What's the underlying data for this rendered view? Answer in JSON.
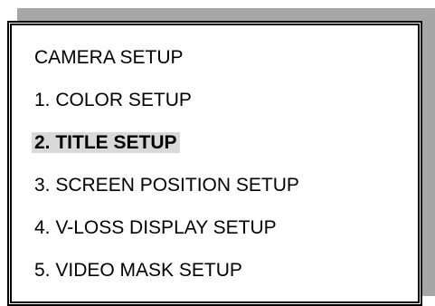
{
  "menu": {
    "title": "CAMERA SETUP",
    "items": [
      {
        "label": "1. COLOR SETUP",
        "selected": false
      },
      {
        "label": "2. TITLE SETUP",
        "selected": true
      },
      {
        "label": "3. SCREEN POSITION SETUP",
        "selected": false
      },
      {
        "label": "4. V-LOSS DISPLAY SETUP",
        "selected": false
      },
      {
        "label": "5. VIDEO MASK SETUP",
        "selected": false
      }
    ]
  }
}
